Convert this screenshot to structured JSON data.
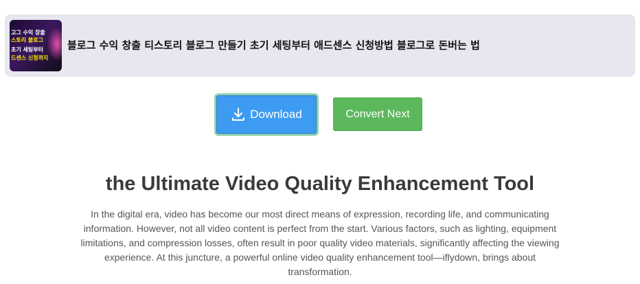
{
  "video": {
    "title": "블로그 수익 창출 티스토리 블로그 만들기 초기 세팅부터 애드센스 신청방법 블로그로 돈버는 법",
    "thumbnail_lines": [
      "고그 수익 창출",
      "스토리 블로그",
      "초기 세팅부터",
      "드센스 신청까지"
    ]
  },
  "actions": {
    "download_label": "Download",
    "download_icon": "download-icon",
    "convert_label": "Convert Next"
  },
  "article": {
    "heading": "the Ultimate Video Quality Enhancement Tool",
    "body": "In the digital era, video has become our most direct means of expression, recording life, and communicating information. However, not all video content is perfect from the start. Various factors, such as lighting, equipment limitations, and compression losses, often result in poor quality video materials, significantly affecting the viewing experience. At this juncture, a powerful online video quality enhancement tool—iflydown, brings about transformation."
  },
  "colors": {
    "download_bg": "#3d9bf1",
    "convert_bg": "#5cb85c",
    "card_bg": "#e7e7ef"
  }
}
